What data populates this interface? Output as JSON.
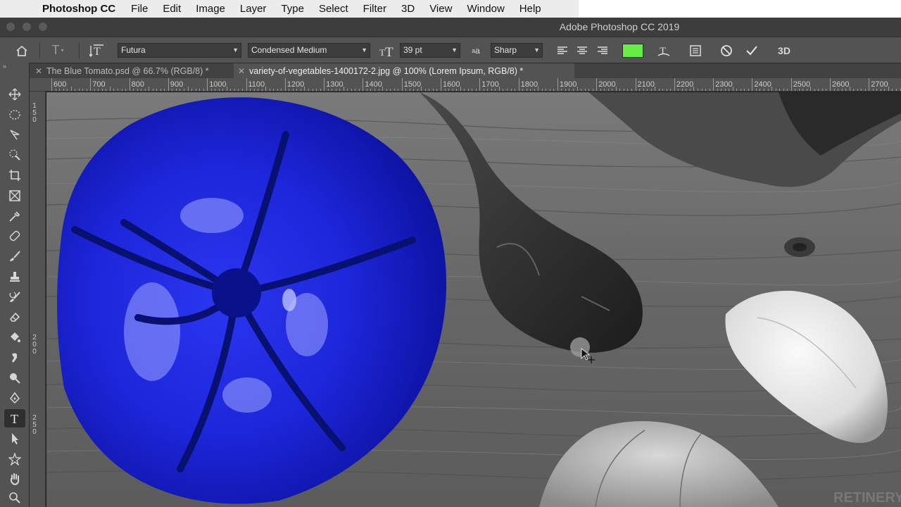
{
  "menubar": {
    "app_name": "Photoshop CC",
    "items": [
      "File",
      "Edit",
      "Image",
      "Layer",
      "Type",
      "Select",
      "Filter",
      "3D",
      "View",
      "Window",
      "Help"
    ]
  },
  "window": {
    "title": "Adobe Photoshop CC 2019"
  },
  "options": {
    "font_family": "Futura",
    "font_style": "Condensed Medium",
    "font_size": "39 pt",
    "antialias": "Sharp",
    "text_color": "#66ee44"
  },
  "tabs": [
    {
      "label": "The Blue Tomato.psd @ 66.7% (RGB/8) *",
      "active": false
    },
    {
      "label": "variety-of-vegetables-1400172-2.jpg @ 100% (Lorem Ipsum, RGB/8) *",
      "active": true
    }
  ],
  "ruler_top": [
    "600",
    "700",
    "800",
    "900",
    "1000",
    "1100",
    "1200",
    "1300",
    "1400",
    "1500",
    "1600",
    "1700",
    "1800",
    "1900",
    "2000",
    "2100",
    "2200",
    "2300",
    "2400",
    "2500",
    "2600",
    "2700"
  ],
  "ruler_left": [
    "150",
    "200",
    "250"
  ],
  "watermark": "RETINERY",
  "colors": {
    "tomato": "#1a22d6",
    "accent_green": "#66ee44"
  }
}
